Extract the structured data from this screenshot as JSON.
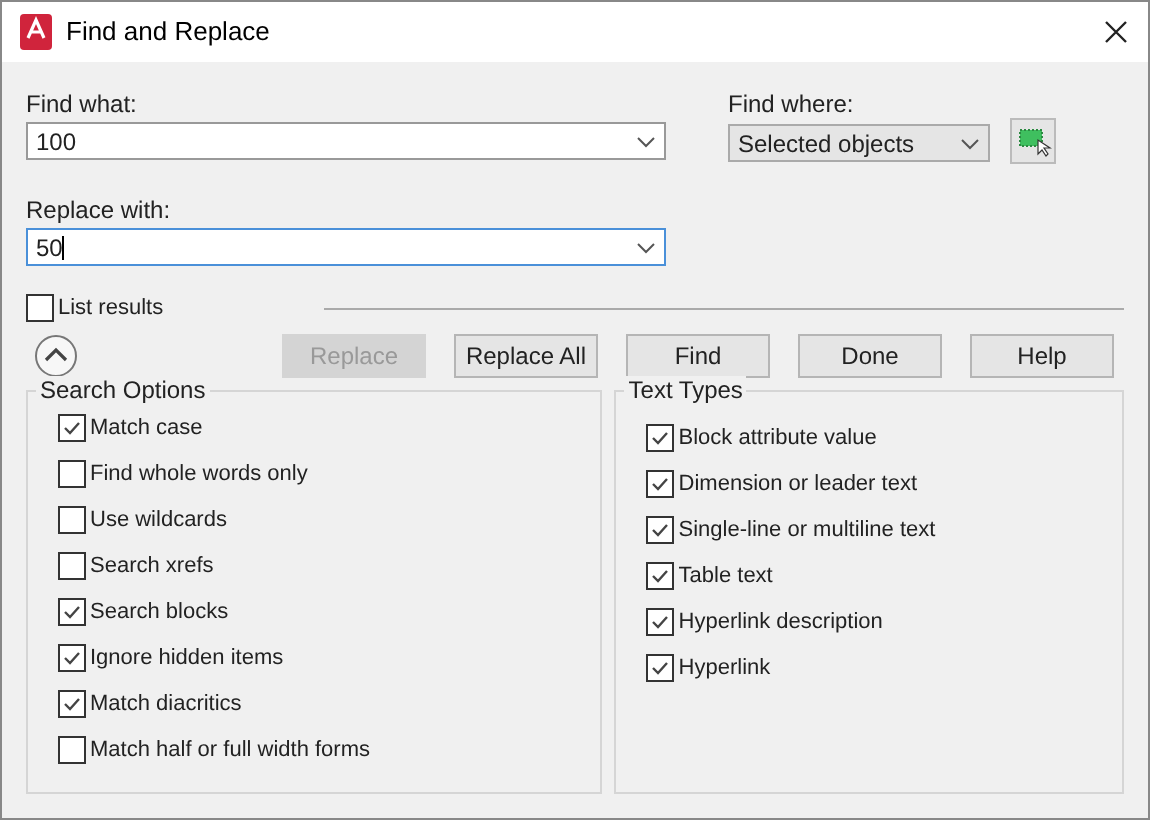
{
  "window": {
    "title": "Find and Replace"
  },
  "find_what": {
    "label": "Find what:",
    "value": "100"
  },
  "find_where": {
    "label": "Find where:",
    "value": "Selected objects"
  },
  "replace_with": {
    "label": "Replace with:",
    "value": "50",
    "focused": true
  },
  "list_results": {
    "label": "List results",
    "checked": false
  },
  "buttons": [
    {
      "label": "Replace",
      "disabled": true
    },
    {
      "label": "Replace All",
      "disabled": false
    },
    {
      "label": "Find",
      "disabled": false
    },
    {
      "label": "Done",
      "disabled": false
    },
    {
      "label": "Help",
      "disabled": false
    }
  ],
  "search_options": {
    "title": "Search Options",
    "items": [
      {
        "label": "Match case",
        "checked": true
      },
      {
        "label": "Find whole words only",
        "checked": false
      },
      {
        "label": "Use wildcards",
        "checked": false
      },
      {
        "label": "Search xrefs",
        "checked": false
      },
      {
        "label": "Search blocks",
        "checked": true
      },
      {
        "label": "Ignore hidden items",
        "checked": true
      },
      {
        "label": "Match diacritics",
        "checked": true
      },
      {
        "label": "Match half or full width forms",
        "checked": false
      }
    ]
  },
  "text_types": {
    "title": "Text Types",
    "items": [
      {
        "label": "Block attribute value",
        "checked": true
      },
      {
        "label": "Dimension or leader text",
        "checked": true
      },
      {
        "label": "Single-line or multiline text",
        "checked": true
      },
      {
        "label": "Table text",
        "checked": true
      },
      {
        "label": "Hyperlink description",
        "checked": true
      },
      {
        "label": "Hyperlink",
        "checked": true
      }
    ]
  }
}
